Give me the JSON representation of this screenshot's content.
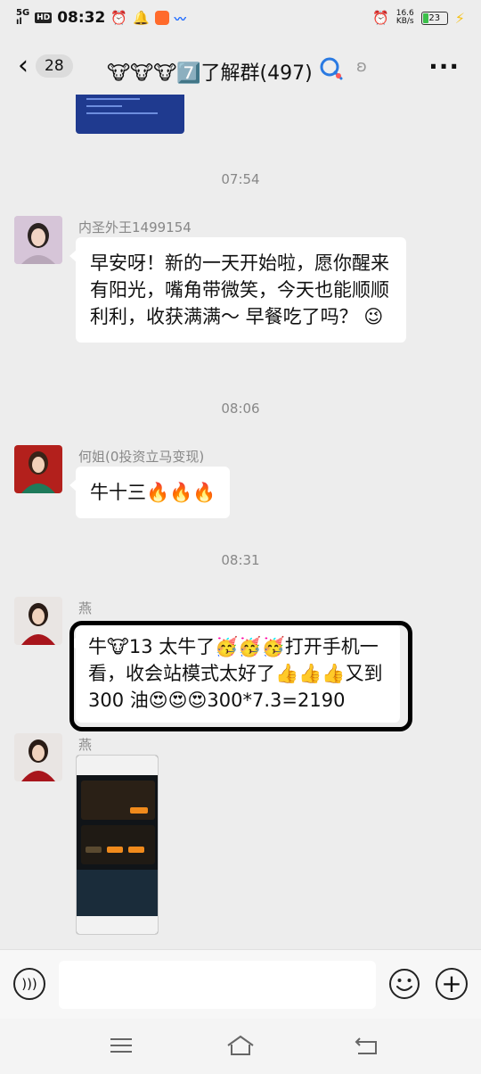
{
  "status_bar": {
    "network": "5G",
    "signal": "ıl",
    "hd": "HD",
    "time": "08:32",
    "speed_value": "16.6",
    "speed_unit": "KB/s",
    "battery": "23"
  },
  "header": {
    "unread_count": "28",
    "title": "🐮🐮🐮7️⃣了解群(497)"
  },
  "chat": {
    "timestamps": [
      "07:54",
      "08:06",
      "08:31"
    ],
    "messages": [
      {
        "sender": "内圣外王1499154",
        "text": "早安呀！新的一天开始啦，愿你醒来有阳光，嘴角带微笑，今天也能顺顺利利，收获满满～ 早餐吃了吗？ 😉"
      },
      {
        "sender": "何姐(0投资立马变现)",
        "text": "牛十三🔥🔥🔥"
      },
      {
        "sender": "燕",
        "text": "牛🐮13 太牛了🥳🥳🥳打开手机一看，收会站模式太好了👍👍👍又到 300 油😍😍😍300*7.3=2190"
      },
      {
        "sender": "燕",
        "image": "screenshot"
      }
    ]
  },
  "input": {
    "placeholder": ""
  },
  "colors": {
    "background": "#ededed",
    "bubble": "#ffffff",
    "highlight": "#000000"
  }
}
